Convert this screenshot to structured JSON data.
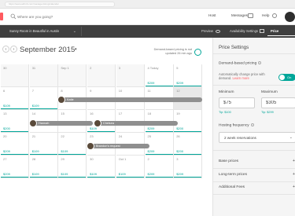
{
  "browser": {
    "address": "https://www.airbnb.com/manage-listing/calendar"
  },
  "header": {
    "search_placeholder": "Where are you going?",
    "nav": {
      "host": "Host",
      "messages": "Messages",
      "help": "Help"
    }
  },
  "toolbar": {
    "listing_name": "Sunny Room in Beautiful in Austin",
    "preview": "Preview",
    "availability": "Availability Settings",
    "price_settings": "Price Settings"
  },
  "calendar": {
    "month": "September 2015",
    "demand_note": "Demand-based pricing is not updated 26 min ago",
    "rows": [
      [
        {
          "n": "30",
          "p": "",
          "s": "past"
        },
        {
          "n": "31",
          "p": "",
          "s": "past"
        },
        {
          "n": "Sep 1",
          "p": "",
          "s": "past"
        },
        {
          "n": "2",
          "p": "",
          "s": "past"
        },
        {
          "n": "3",
          "p": "",
          "s": "past"
        },
        {
          "n": "4 Today",
          "p": "$209",
          "s": "normal"
        },
        {
          "n": "5",
          "p": "$209",
          "s": "normal"
        }
      ],
      [
        {
          "n": "6",
          "p": "$109",
          "s": "normal"
        },
        {
          "n": "7",
          "p": "$109",
          "s": "normal"
        },
        {
          "n": "8",
          "p": "",
          "s": "normal"
        },
        {
          "n": "9",
          "p": "",
          "s": "normal"
        },
        {
          "n": "10",
          "p": "",
          "s": "normal"
        },
        {
          "n": "11",
          "p": "",
          "s": "normal"
        },
        {
          "n": "12",
          "p": "",
          "s": "blocked"
        }
      ],
      [
        {
          "n": "13",
          "p": "$200",
          "s": "normal"
        },
        {
          "n": "14",
          "p": "",
          "s": "normal"
        },
        {
          "n": "15",
          "p": "",
          "s": "normal"
        },
        {
          "n": "16",
          "p": "$109",
          "s": "normal"
        },
        {
          "n": "17",
          "p": "",
          "s": "normal"
        },
        {
          "n": "18",
          "p": "$209",
          "s": "normal"
        },
        {
          "n": "19",
          "p": "$200",
          "s": "normal"
        }
      ],
      [
        {
          "n": "20",
          "p": "$209",
          "s": "normal"
        },
        {
          "n": "21",
          "p": "$109",
          "s": "normal"
        },
        {
          "n": "22",
          "p": "$109",
          "s": "normal"
        },
        {
          "n": "23",
          "p": "",
          "s": "normal"
        },
        {
          "n": "24",
          "p": "",
          "s": "normal"
        },
        {
          "n": "25",
          "p": "$209",
          "s": "normal"
        },
        {
          "n": "26",
          "p": "$200",
          "s": "normal"
        }
      ],
      [
        {
          "n": "27",
          "p": "$209",
          "s": "normal"
        },
        {
          "n": "28",
          "p": "$109",
          "s": "normal"
        },
        {
          "n": "29",
          "p": "$109",
          "s": "normal"
        },
        {
          "n": "30",
          "p": "$109",
          "s": "normal"
        },
        {
          "n": "Oct 1",
          "p": "$109",
          "s": "normal"
        },
        {
          "n": "2",
          "p": "$209",
          "s": "normal"
        },
        {
          "n": "3",
          "p": "$209",
          "s": "normal"
        }
      ]
    ],
    "bookings": {
      "katie": "Katie",
      "hannah": "Hannah",
      "chelsea": "Chelsea",
      "brandon": "Brandon's request"
    }
  },
  "panel": {
    "title": "Price Settings",
    "demand_label": "Demand-based pricing",
    "auto_text": "Automatically change price with demand.",
    "learn_more": "Learn more",
    "toggle_label": "On",
    "minimum_label": "Minimum",
    "minimum_value": "$75",
    "minimum_tip": "Tip: $100",
    "maximum_label": "Maximum",
    "maximum_value": "$305",
    "maximum_tip": "Tip: $299",
    "frequency_label": "Hosting frequency",
    "frequency_value": "2 week reservations",
    "base_prices": "Base prices",
    "long_term": "Long-term prices",
    "additional_fees": "Additional Fees"
  },
  "colors": {
    "accent": "#00a699",
    "brand": "#ff5a5f",
    "toolbar": "#3f3f3f"
  }
}
